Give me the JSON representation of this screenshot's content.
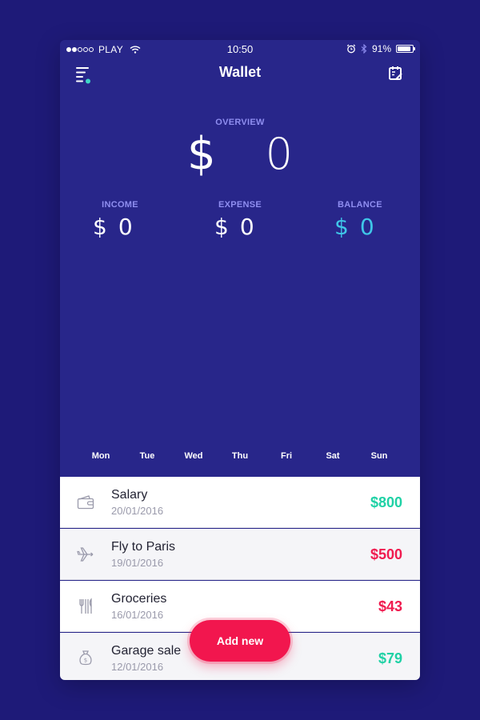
{
  "status_bar": {
    "carrier": "PLAY",
    "time": "10:50",
    "battery": "91%",
    "battery_level": 0.91
  },
  "nav": {
    "title": "Wallet",
    "menu_icon": "menu-icon",
    "calendar_icon": "calendar-icon"
  },
  "overview": {
    "label": "OVERVIEW",
    "currency": "$",
    "value": "0"
  },
  "stats": {
    "income": {
      "label": "INCOME",
      "currency": "$",
      "value": "0"
    },
    "expense": {
      "label": "EXPENSE",
      "currency": "$",
      "value": "0"
    },
    "balance": {
      "label": "BALANCE",
      "currency": "$",
      "value": "0"
    }
  },
  "weekdays": [
    "Mon",
    "Tue",
    "Wed",
    "Thu",
    "Fri",
    "Sat",
    "Sun"
  ],
  "transactions": [
    {
      "name": "Salary",
      "date": "20/01/2016",
      "amount": "$800",
      "type": "positive",
      "icon": "wallet-icon"
    },
    {
      "name": "Fly to Paris",
      "date": "19/01/2016",
      "amount": "$500",
      "type": "negative",
      "icon": "airplane-icon"
    },
    {
      "name": "Groceries",
      "date": "16/01/2016",
      "amount": "$43",
      "type": "negative",
      "icon": "cutlery-icon"
    },
    {
      "name": "Garage sale",
      "date": "12/01/2016",
      "amount": "$79",
      "type": "positive",
      "icon": "money-bag-icon"
    }
  ],
  "add_button": {
    "label": "Add new"
  },
  "colors": {
    "background": "#1e1a78",
    "panel": "#28268a",
    "accent": "#f2164e",
    "positive": "#1fd1a5",
    "negative": "#f01b4f",
    "label": "#8f8ef0",
    "balance": "#3fc6e8"
  }
}
